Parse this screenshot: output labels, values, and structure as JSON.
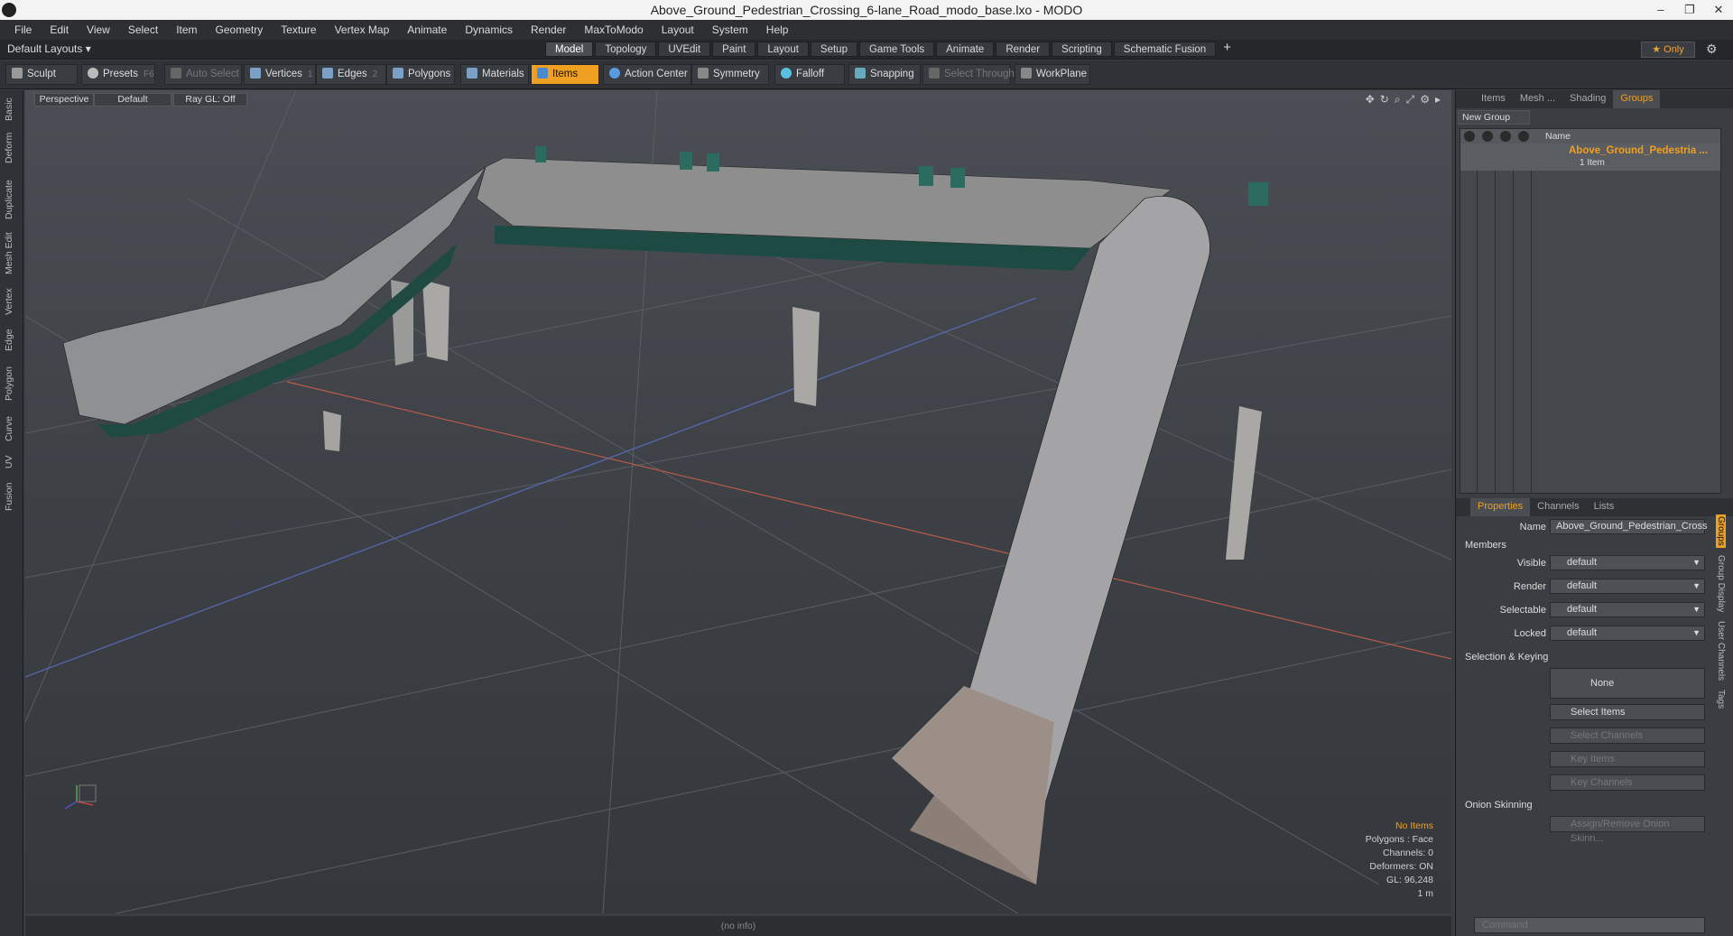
{
  "window": {
    "title": "Above_Ground_Pedestrian_Crossing_6-lane_Road_modo_base.lxo - MODO"
  },
  "menu": [
    "File",
    "Edit",
    "View",
    "Select",
    "Item",
    "Geometry",
    "Texture",
    "Vertex Map",
    "Animate",
    "Dynamics",
    "Render",
    "MaxToModo",
    "Layout",
    "System",
    "Help"
  ],
  "layout": {
    "label": "Default Layouts ▾",
    "tabs": [
      "Model",
      "Topology",
      "UVEdit",
      "Paint",
      "Layout",
      "Setup",
      "Game Tools",
      "Animate",
      "Render",
      "Scripting",
      "Schematic Fusion"
    ],
    "active_tab": "Model",
    "only": "★ Only"
  },
  "toolbar": {
    "sculpt": "Sculpt",
    "presets": "Presets",
    "presets_key": "F6",
    "auto_select": "Auto Select",
    "vertices": "Vertices",
    "vertices_n": "1",
    "edges": "Edges",
    "edges_n": "2",
    "polygons": "Polygons",
    "materials": "Materials",
    "items": "Items",
    "action_center": "Action Center",
    "symmetry": "Symmetry",
    "falloff": "Falloff",
    "snapping": "Snapping",
    "select_through": "Select Through",
    "workplane": "WorkPlane"
  },
  "left_tabs": [
    "Basic",
    "Deform",
    "Duplicate",
    "Mesh Edit",
    "Vertex",
    "Edge",
    "Polygon",
    "Curve",
    "UV",
    "Fusion"
  ],
  "viewport": {
    "view": "Perspective",
    "shading": "Default",
    "raygl": "Ray GL: Off",
    "status": {
      "items": "No Items",
      "polygons": "Polygons : Face",
      "channels": "Channels: 0",
      "deformers": "Deformers: ON",
      "gl": "GL: 96,248",
      "scale": "1 m"
    },
    "info": "(no info)"
  },
  "groups_panel": {
    "tabs": [
      "Items",
      "Mesh ...",
      "Shading",
      "Groups"
    ],
    "active": "Groups",
    "new_group": "New Group",
    "col_name": "Name",
    "group_name": "Above_Ground_Pedestria ...",
    "group_count": "1 Item"
  },
  "properties": {
    "tabs": [
      "Properties",
      "Channels",
      "Lists"
    ],
    "active": "Properties",
    "name_label": "Name",
    "name_value": "Above_Ground_Pedestrian_Cross",
    "members": "Members",
    "visible": "Visible",
    "render": "Render",
    "selectable": "Selectable",
    "locked": "Locked",
    "default": "default",
    "sel_keying": "Selection & Keying",
    "none": "None",
    "select_items": "Select Items",
    "select_channels": "Select Channels",
    "key_items": "Key Items",
    "key_channels": "Key Channels",
    "onion": "Onion Skinning",
    "assign_onion": "Assign/Remove Onion Skinn...",
    "side_tabs": [
      "Groups",
      "Group Display",
      "User Channels",
      "Tags"
    ]
  },
  "command": {
    "placeholder": "Command"
  }
}
